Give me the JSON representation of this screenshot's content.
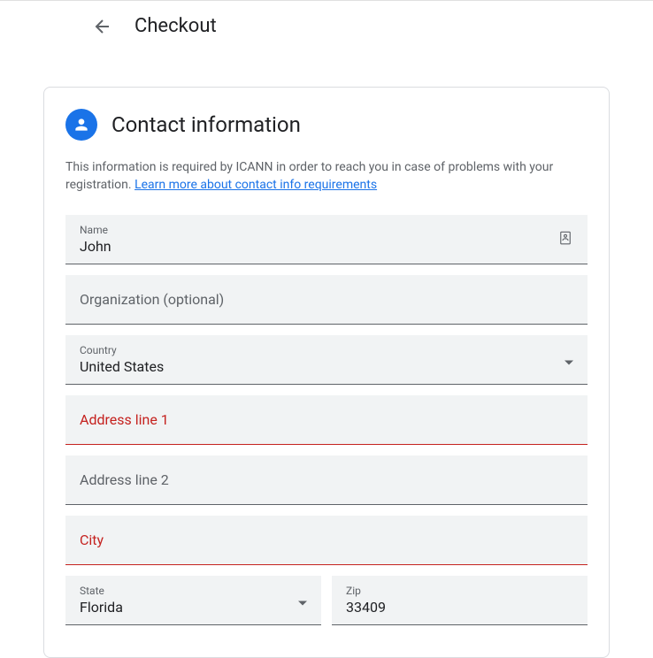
{
  "header": {
    "title": "Checkout"
  },
  "section": {
    "title": "Contact information",
    "info_text": "This information is required by ICANN in order to reach you in case of problems with your registration. ",
    "link_text": "Learn more about contact info requirements"
  },
  "fields": {
    "name": {
      "label": "Name",
      "value": "John"
    },
    "organization": {
      "placeholder": "Organization (optional)"
    },
    "country": {
      "label": "Country",
      "value": "United States"
    },
    "address1": {
      "placeholder": "Address line 1"
    },
    "address2": {
      "placeholder": "Address line 2"
    },
    "city": {
      "placeholder": "City"
    },
    "state": {
      "label": "State",
      "value": "Florida"
    },
    "zip": {
      "label": "Zip",
      "value": "33409"
    }
  }
}
